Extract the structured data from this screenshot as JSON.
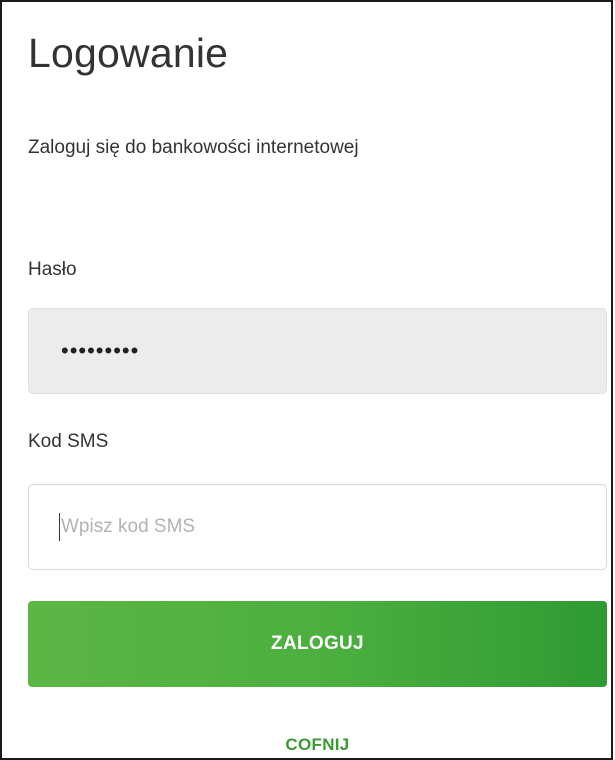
{
  "login": {
    "title": "Logowanie",
    "subtitle": "Zaloguj się do bankowości internetowej",
    "password": {
      "label": "Hasło",
      "value": "•••••••••"
    },
    "sms": {
      "label": "Kod SMS",
      "placeholder": "Wpisz kod SMS",
      "value": ""
    },
    "submit_label": "ZALOGUJ",
    "back_label": "COFNIJ"
  },
  "colors": {
    "accent": "#4aae3e",
    "link": "#3a9a32",
    "password_bg": "#ececec"
  }
}
